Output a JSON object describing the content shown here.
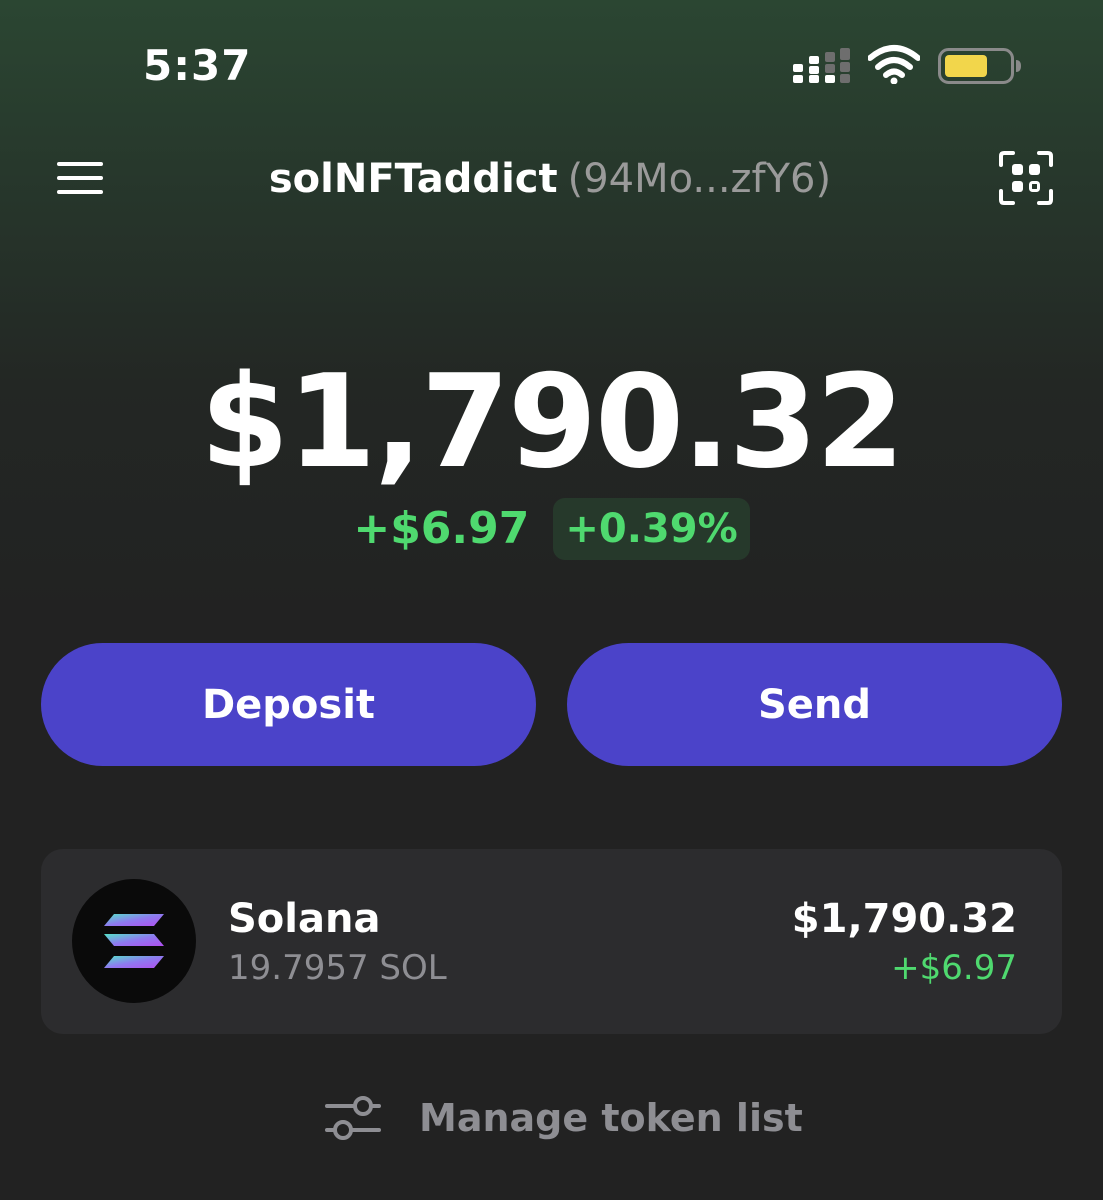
{
  "status_bar": {
    "time": "5:37",
    "icons": [
      "signal-icon",
      "wifi-icon",
      "battery-icon"
    ],
    "battery_color": "#f2d64b"
  },
  "header": {
    "account_name": "solNFTaddict",
    "account_address": "(94Mo...zfY6)",
    "left_icon": "menu-icon",
    "right_icon": "qr-scan-icon"
  },
  "balance": {
    "total": "$1,790.32",
    "change_amount": "+$6.97",
    "change_percent": "+0.39%",
    "positive_color": "#4fd96f"
  },
  "actions": {
    "deposit_label": "Deposit",
    "send_label": "Send",
    "button_color": "#4b43c9"
  },
  "tokens": [
    {
      "name": "Solana",
      "amount": "19.7957 SOL",
      "value": "$1,790.32",
      "change": "+$6.97",
      "icon": "solana-logo-icon"
    }
  ],
  "footer": {
    "manage_label": "Manage token list",
    "icon": "sliders-icon"
  }
}
